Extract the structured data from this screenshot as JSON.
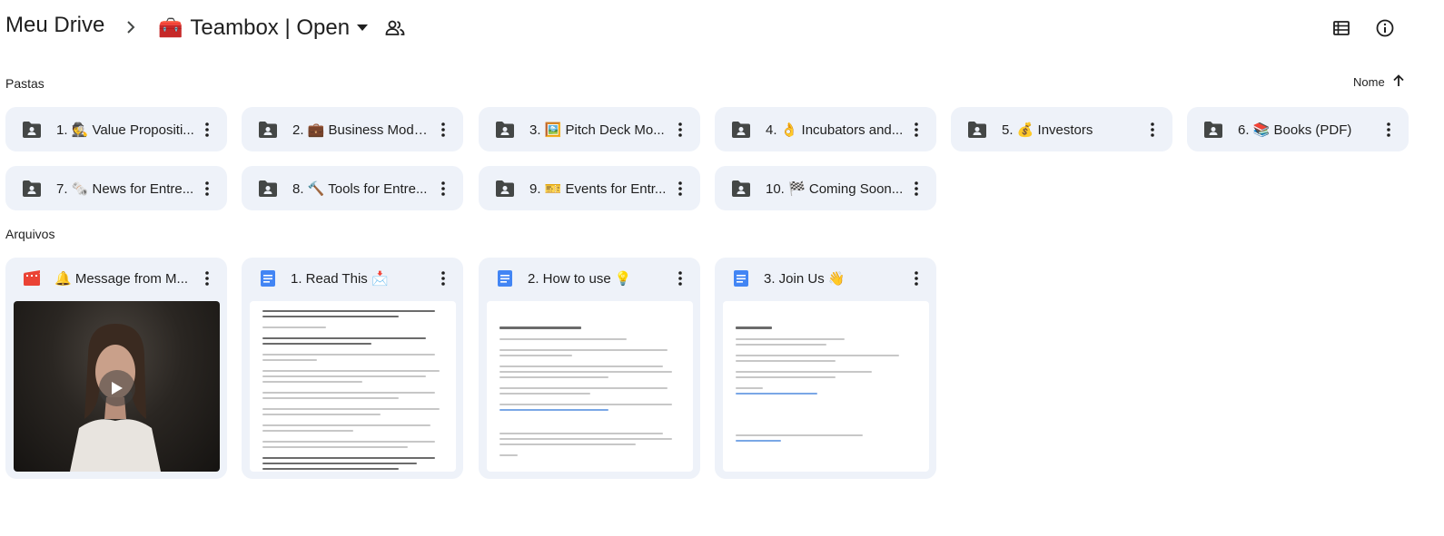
{
  "header": {
    "root_label": "Meu Drive",
    "current_emoji": "🧰",
    "current_title": "Teambox | Open"
  },
  "sections": {
    "folders_label": "Pastas",
    "files_label": "Arquivos"
  },
  "sort": {
    "label": "Nome",
    "direction": "ascending"
  },
  "folders": [
    {
      "label": "1. 🕵️ Value Propositi..."
    },
    {
      "label": "2. 💼 Business Mode..."
    },
    {
      "label": "3. 🖼️ Pitch Deck Mo..."
    },
    {
      "label": "4. 👌 Incubators and..."
    },
    {
      "label": "5. 💰 Investors"
    },
    {
      "label": "6. 📚 Books (PDF)"
    },
    {
      "label": "7. 🗞️ News for Entre..."
    },
    {
      "label": "8. 🔨 Tools for Entre..."
    },
    {
      "label": "9. 🎫 Events for Entr..."
    },
    {
      "label": "10. 🏁 Coming Soon..."
    }
  ],
  "files": [
    {
      "label": "🔔 Message from M...",
      "type": "video"
    },
    {
      "label": "1. Read This 📩",
      "type": "doc"
    },
    {
      "label": "2. How to use 💡",
      "type": "doc"
    },
    {
      "label": "3. Join Us 👋",
      "type": "doc"
    }
  ],
  "colors": {
    "card_bg": "#eef2f9",
    "doc_blue": "#4285f4",
    "video_red": "#ea4335",
    "icon_gray": "#444746"
  }
}
